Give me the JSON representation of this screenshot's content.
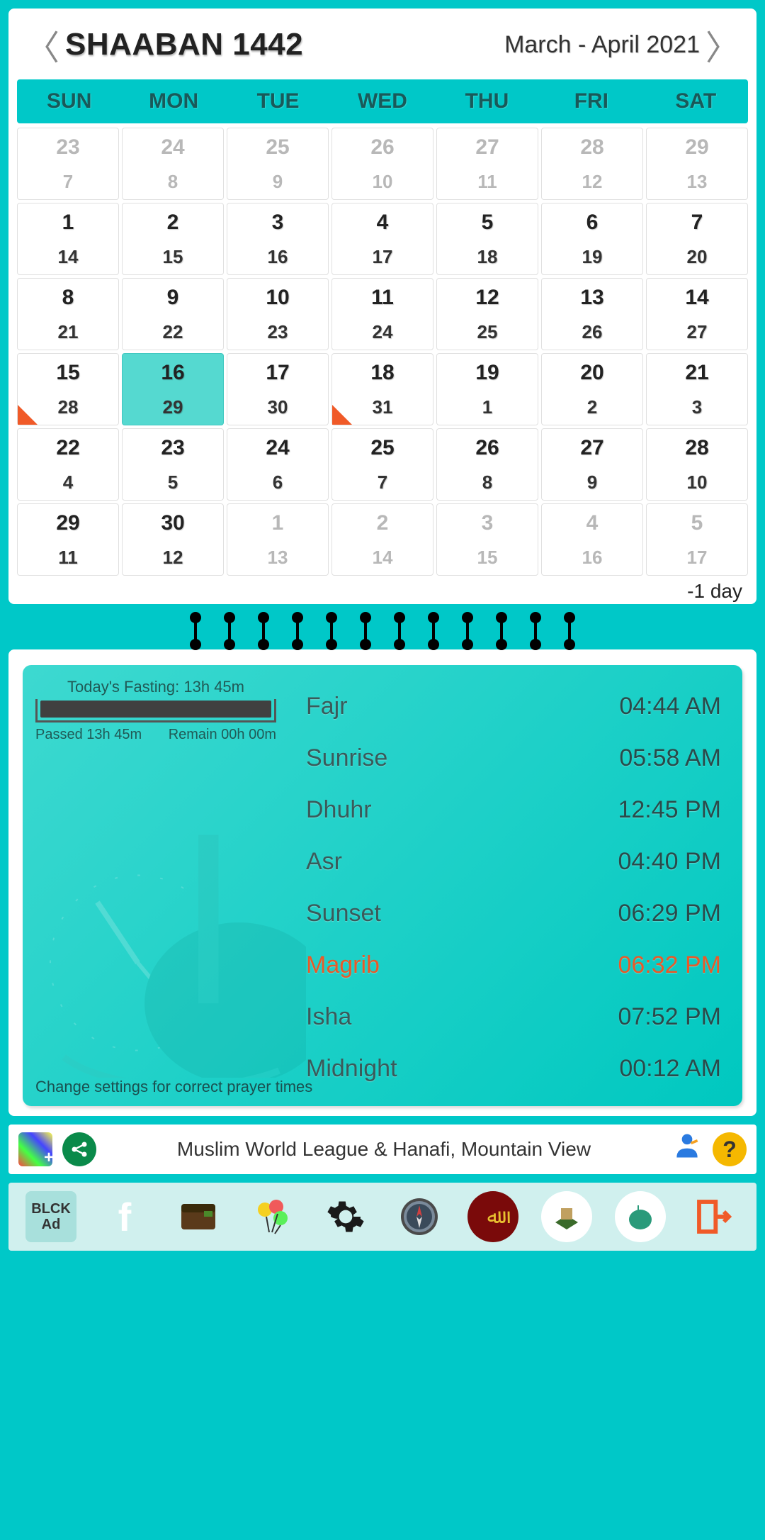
{
  "header": {
    "hijri_month": "SHAABAN 1442",
    "gregorian_range": "March - April 2021"
  },
  "weekdays": [
    "SUN",
    "MON",
    "TUE",
    "WED",
    "THU",
    "FRI",
    "SAT"
  ],
  "calendar": {
    "offset_label": "-1 day",
    "rows": [
      [
        {
          "h": "23",
          "g": "7",
          "muted": true
        },
        {
          "h": "24",
          "g": "8",
          "muted": true
        },
        {
          "h": "25",
          "g": "9",
          "muted": true
        },
        {
          "h": "26",
          "g": "10",
          "muted": true
        },
        {
          "h": "27",
          "g": "11",
          "muted": true
        },
        {
          "h": "28",
          "g": "12",
          "muted": true
        },
        {
          "h": "29",
          "g": "13",
          "muted": true
        }
      ],
      [
        {
          "h": "1",
          "g": "14"
        },
        {
          "h": "2",
          "g": "15"
        },
        {
          "h": "3",
          "g": "16"
        },
        {
          "h": "4",
          "g": "17"
        },
        {
          "h": "5",
          "g": "18"
        },
        {
          "h": "6",
          "g": "19"
        },
        {
          "h": "7",
          "g": "20"
        }
      ],
      [
        {
          "h": "8",
          "g": "21"
        },
        {
          "h": "9",
          "g": "22"
        },
        {
          "h": "10",
          "g": "23"
        },
        {
          "h": "11",
          "g": "24"
        },
        {
          "h": "12",
          "g": "25"
        },
        {
          "h": "13",
          "g": "26"
        },
        {
          "h": "14",
          "g": "27"
        }
      ],
      [
        {
          "h": "15",
          "g": "28",
          "marker": true
        },
        {
          "h": "16",
          "g": "29",
          "selected": true
        },
        {
          "h": "17",
          "g": "30"
        },
        {
          "h": "18",
          "g": "31",
          "marker": true
        },
        {
          "h": "19",
          "g": "1"
        },
        {
          "h": "20",
          "g": "2"
        },
        {
          "h": "21",
          "g": "3"
        }
      ],
      [
        {
          "h": "22",
          "g": "4"
        },
        {
          "h": "23",
          "g": "5"
        },
        {
          "h": "24",
          "g": "6"
        },
        {
          "h": "25",
          "g": "7"
        },
        {
          "h": "26",
          "g": "8"
        },
        {
          "h": "27",
          "g": "9"
        },
        {
          "h": "28",
          "g": "10"
        }
      ],
      [
        {
          "h": "29",
          "g": "11"
        },
        {
          "h": "30",
          "g": "12"
        },
        {
          "h": "1",
          "g": "13",
          "muted": true
        },
        {
          "h": "2",
          "g": "14",
          "muted": true
        },
        {
          "h": "3",
          "g": "15",
          "muted": true
        },
        {
          "h": "4",
          "g": "16",
          "muted": true
        },
        {
          "h": "5",
          "g": "17",
          "muted": true
        }
      ]
    ]
  },
  "fasting": {
    "title": "Today's Fasting: 13h 45m",
    "passed": "Passed 13h 45m",
    "remain": "Remain 00h 00m"
  },
  "prayers": [
    {
      "name": "Fajr",
      "time": "04:44 AM"
    },
    {
      "name": "Sunrise",
      "time": "05:58 AM"
    },
    {
      "name": "Dhuhr",
      "time": "12:45 PM"
    },
    {
      "name": "Asr",
      "time": "04:40 PM"
    },
    {
      "name": "Sunset",
      "time": "06:29 PM"
    },
    {
      "name": "Magrib",
      "time": "06:32 PM",
      "highlight": true
    },
    {
      "name": "Isha",
      "time": "07:52 PM"
    },
    {
      "name": "Midnight",
      "time": "00:12 AM"
    }
  ],
  "settings_hint": "Change settings for correct prayer times",
  "info": {
    "text": "Muslim World League & Hanafi, Mountain View"
  },
  "bottom": {
    "block_ad_1": "BLCK",
    "block_ad_2": "Ad"
  }
}
